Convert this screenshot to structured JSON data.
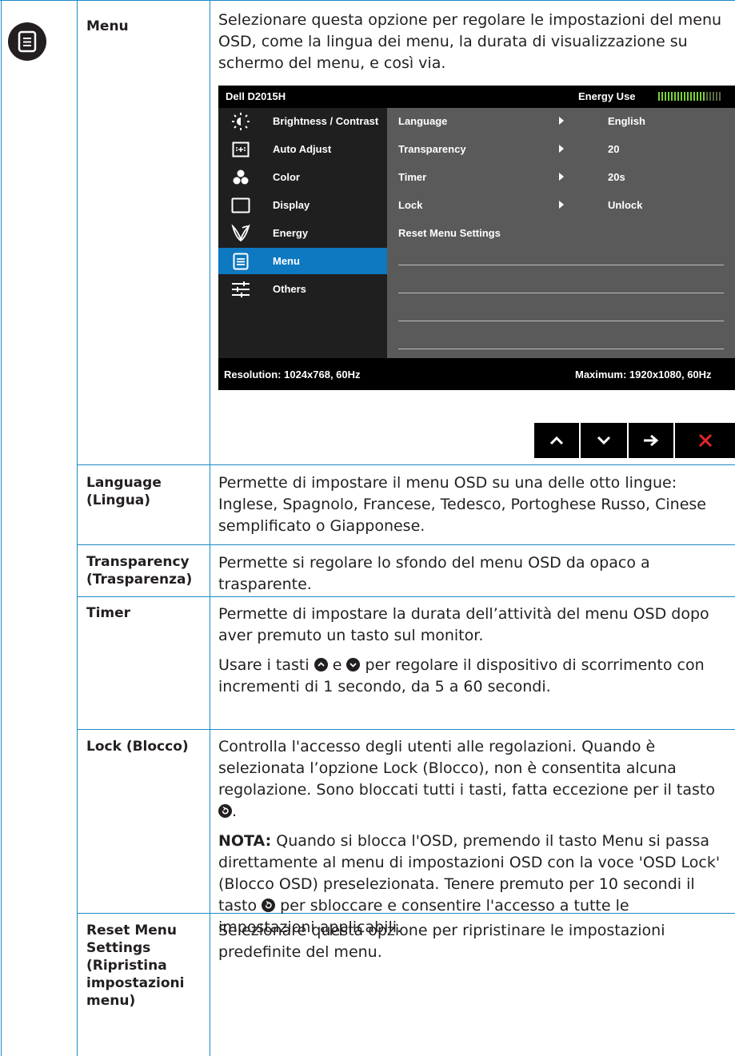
{
  "sections": [
    {
      "label": "Menu",
      "description": "Selezionare questa opzione per regolare le impostazioni del menu OSD, come la lingua dei menu, la durata di visualizzazione su schermo del menu, e così via."
    },
    {
      "label": "Language (Lingua)",
      "description": "Permette di impostare il menu OSD su una delle otto lingue: Inglese, Spagnolo, Francese, Tedesco, Portoghese Russo, Cinese semplificato o Giapponese."
    },
    {
      "label": "Transparency (Trasparenza)",
      "description": "Permette si regolare lo sfondo del menu OSD da opaco a trasparente."
    },
    {
      "label": "Timer",
      "description": "Permette di impostare la durata dell’attività del menu OSD dopo aver premuto un tasto sul monitor.",
      "description2_a": "Usare i tasti",
      "description2_b": "e",
      "description2_c": "per regolare il dispositivo di scorrimento con incrementi di 1 secondo, da 5 a 60 secondi."
    },
    {
      "label": "Lock (Blocco)",
      "description_a": "Controlla l'accesso degli utenti alle regolazioni. Quando è selezionata l’opzione Lock (Blocco), non è consentita alcuna regolazione. Sono bloccati tutti i tasti, fatta eccezione per il tasto",
      "description_b": ".",
      "note_label": "NOTA:",
      "note_a": "Quando si blocca l'OSD, premendo il tasto Menu si passa direttamente al menu di impostazioni OSD con la voce 'OSD Lock' (Blocco OSD) preselezionata. Tenere premuto per 10 secondi il tasto",
      "note_b": "per sbloccare e consentire l'accesso a tutte le impostazioni applicabili."
    },
    {
      "label": "Reset Menu Settings (Ripristina impostazioni menu)",
      "description": "Selezionare questa opzione per ripristinare le impostazioni predefinite del menu."
    }
  ],
  "osd": {
    "model": "Dell D2015H",
    "energy_label": "Energy Use",
    "energy_bars_lit": 15,
    "energy_bars_total": 20,
    "categories": [
      {
        "label": "Brightness / Contrast",
        "icon": "brightness-icon",
        "selected": false
      },
      {
        "label": "Auto Adjust",
        "icon": "auto-adjust-icon",
        "selected": false
      },
      {
        "label": "Color",
        "icon": "color-icon",
        "selected": false
      },
      {
        "label": "Display",
        "icon": "display-icon",
        "selected": false
      },
      {
        "label": "Energy",
        "icon": "energy-icon",
        "selected": false
      },
      {
        "label": "Menu",
        "icon": "menu-icon",
        "selected": true
      },
      {
        "label": "Others",
        "icon": "others-icon",
        "selected": false
      }
    ],
    "settings": [
      {
        "name": "Language",
        "value": "English"
      },
      {
        "name": "Transparency",
        "value": "20"
      },
      {
        "name": "Timer",
        "value": "20s"
      },
      {
        "name": "Lock",
        "value": "Unlock"
      },
      {
        "name": "Reset Menu Settings",
        "value": ""
      }
    ],
    "resolution": "Resolution: 1024x768, 60Hz",
    "maximum": "Maximum: 1920x1080, 60Hz"
  },
  "nav_buttons": [
    {
      "name": "up-button",
      "icon": "chevron-up-icon"
    },
    {
      "name": "down-button",
      "icon": "chevron-down-icon"
    },
    {
      "name": "enter-button",
      "icon": "arrow-right-icon"
    },
    {
      "name": "exit-button",
      "icon": "close-icon",
      "color": "#e3262b"
    }
  ],
  "colors": {
    "rule": "#1b8bc7",
    "selected": "#0e78c0",
    "meter": "#7bd23c"
  }
}
